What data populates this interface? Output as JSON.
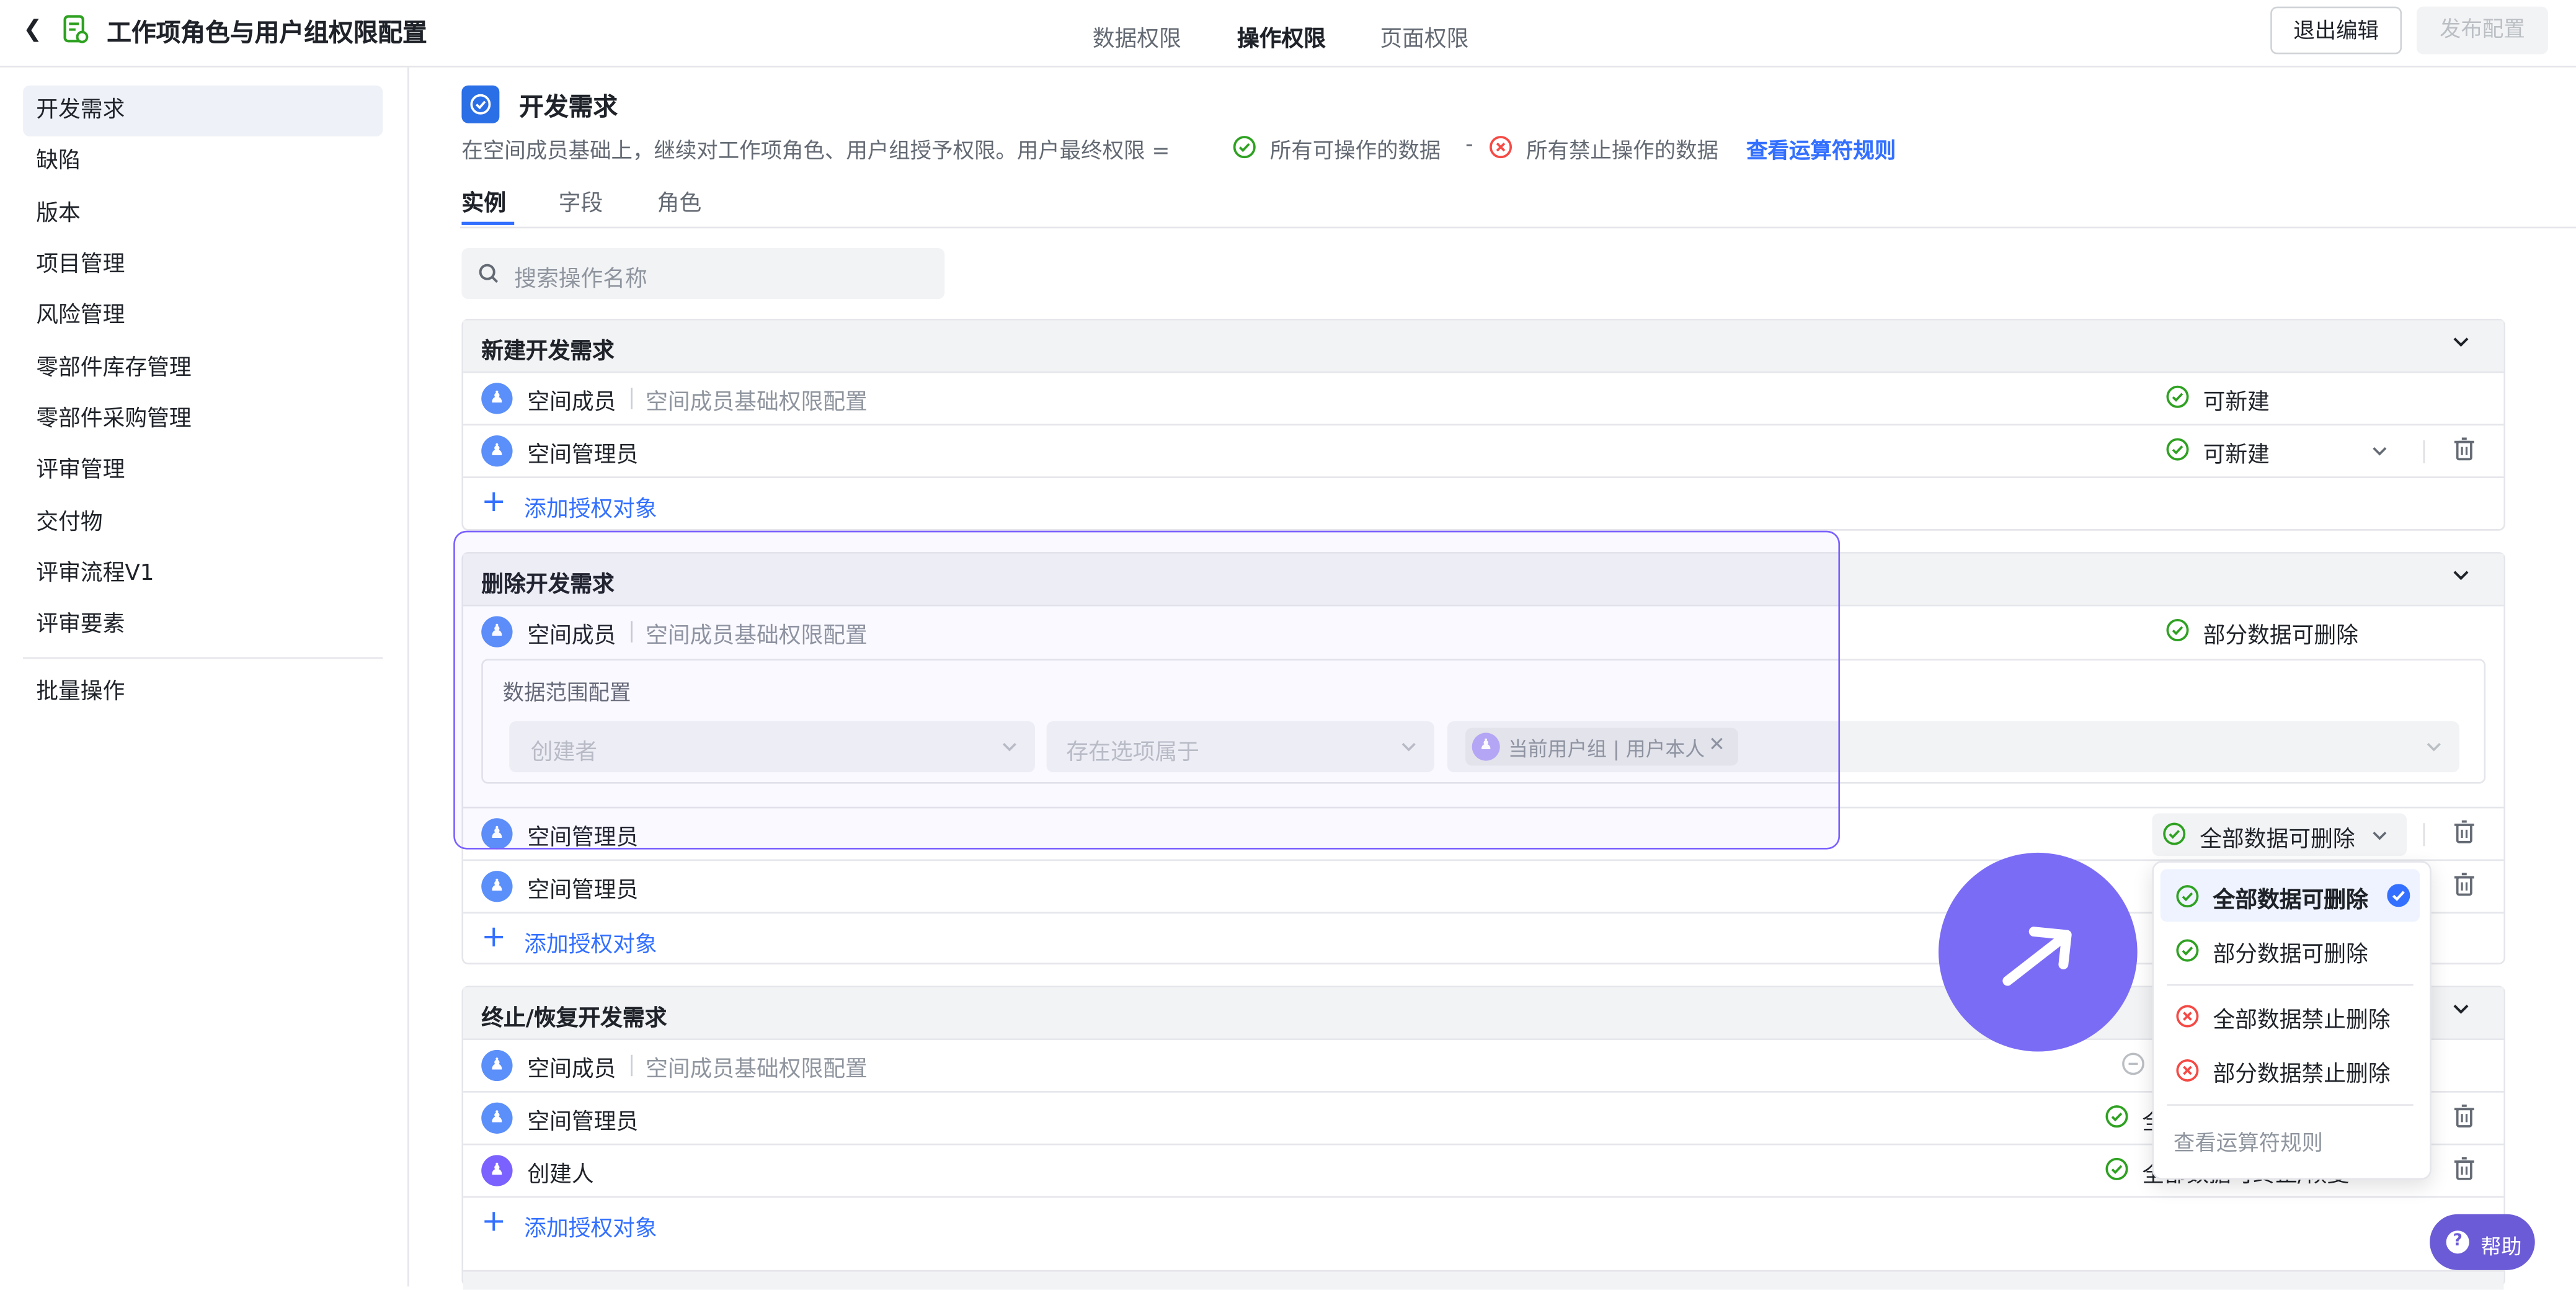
{
  "header": {
    "back_icon": "chevron-left-icon",
    "title": "工作项角色与用户组权限配置",
    "tabs": [
      "数据权限",
      "操作权限",
      "页面权限"
    ],
    "active_tab": "操作权限",
    "exit_button": "退出编辑",
    "publish_button": "发布配置"
  },
  "sidebar": {
    "items": [
      "开发需求",
      "缺陷",
      "版本",
      "项目管理",
      "风险管理",
      "零部件库存管理",
      "零部件采购管理",
      "评审管理",
      "交付物",
      "评审流程V1",
      "评审要素"
    ],
    "bottom_item": "批量操作",
    "active": "开发需求"
  },
  "main": {
    "title": "开发需求",
    "desc_prefix": "在空间成员基础上，继续对工作项角色、用户组授予权限。用户最终权限 =",
    "desc_allowed": "所有可操作的数据",
    "desc_minus": "-",
    "desc_forbidden": "所有禁止操作的数据",
    "desc_link": "查看运算符规则",
    "tabs": [
      "实例",
      "字段",
      "角色"
    ],
    "active_tab": "实例",
    "search_placeholder": "搜索操作名称"
  },
  "sections": {
    "create": {
      "title": "新建开发需求",
      "rows": [
        {
          "name": "空间成员",
          "sub": "空间成员基础权限配置",
          "perm": "可新建"
        },
        {
          "name": "空间管理员",
          "perm": "可新建"
        }
      ],
      "add": "添加授权对象"
    },
    "delete": {
      "title": "删除开发需求",
      "member": {
        "name": "空间成员",
        "sub": "空间成员基础权限配置",
        "perm": "部分数据可删除"
      },
      "scope_title": "数据范围配置",
      "scope_field": "创建者",
      "scope_op": "存在选项属于",
      "scope_tag": "当前用户组 | 用户本人",
      "admin1": {
        "name": "空间管理员",
        "perm": "全部数据可删除"
      },
      "admin2": {
        "name": "空间管理员"
      },
      "add": "添加授权对象"
    },
    "stop": {
      "title": "终止/恢复开发需求",
      "member": {
        "name": "空间成员",
        "sub": "空间成员基础权限配置"
      },
      "admin": {
        "name": "空间管理员",
        "perm_partial": "全"
      },
      "creator": {
        "name": "创建人",
        "perm_partial": "全部数据可终止/恢复"
      },
      "add": "添加授权对象"
    }
  },
  "dropdown": {
    "options": [
      "全部数据可删除",
      "部分数据可删除",
      "全部数据禁止删除",
      "部分数据禁止删除"
    ],
    "selected": "全部数据可删除",
    "footer_link": "查看运算符规则"
  },
  "help_button": "帮助",
  "colors": {
    "accent": "#3370ff",
    "success": "#2ea121",
    "danger": "#f54a45",
    "highlight": "#7b61ff",
    "cursor_bubble": "#7b6cf6"
  }
}
